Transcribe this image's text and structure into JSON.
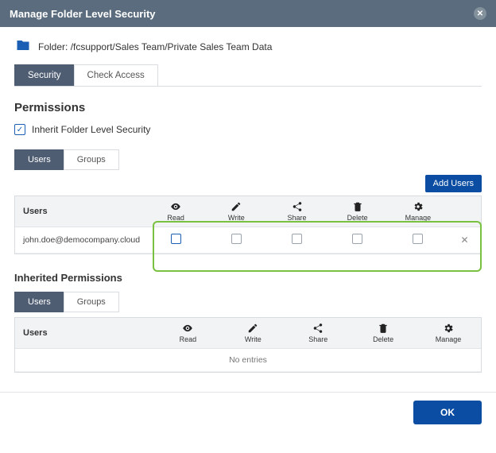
{
  "titlebar": {
    "title": "Manage Folder Level Security"
  },
  "folder": {
    "label": "Folder:",
    "path": "/fcsupport/Sales Team/Private Sales Team Data"
  },
  "topTabs": {
    "security": "Security",
    "checkAccess": "Check Access"
  },
  "headings": {
    "permissions": "Permissions",
    "inherited": "Inherited Permissions"
  },
  "inherit": {
    "label": "Inherit Folder Level Security",
    "checked": true
  },
  "subTabs": {
    "users": "Users",
    "groups": "Groups"
  },
  "buttons": {
    "addUsers": "Add Users",
    "ok": "OK"
  },
  "columns": {
    "users": "Users",
    "read": "Read",
    "write": "Write",
    "share": "Share",
    "delete": "Delete",
    "manage": "Manage"
  },
  "permissions": {
    "rows": [
      {
        "user": "john.doe@democompany.cloud",
        "read": false,
        "write": false,
        "share": false,
        "delete": false,
        "manage": false
      }
    ]
  },
  "inheritedPermissions": {
    "empty": "No entries"
  }
}
